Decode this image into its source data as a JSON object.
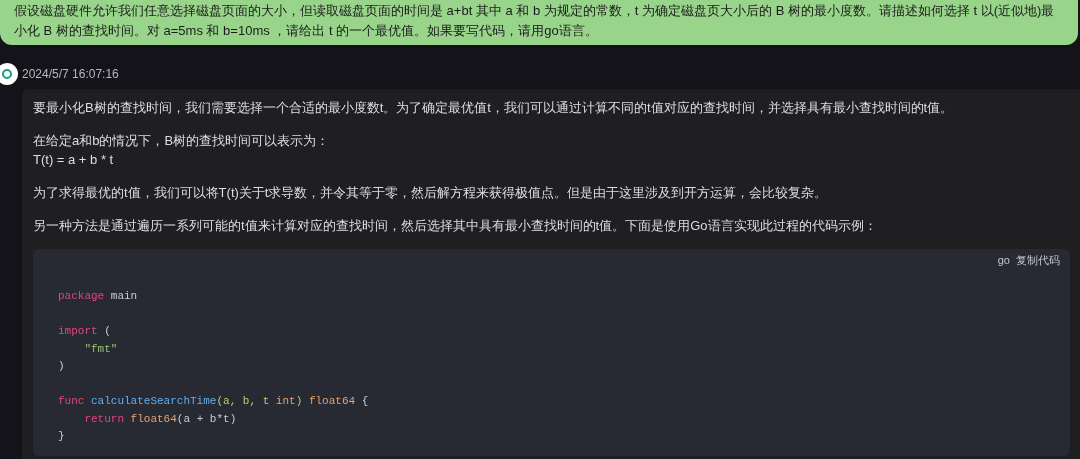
{
  "question": {
    "text": "假设磁盘硬件允许我们任意选择磁盘页面的大小，但读取磁盘页面的时间是 a+bt 其中 a 和 b 为规定的常数，t 为确定磁盘页大小后的 B 树的最小度数。请描述如何选择 t 以(近似地)最小化 B 树的查找时间。对 a=5ms 和 b=10ms ，请给出 t 的一个最优值。如果要写代码，请用go语言。"
  },
  "answer": {
    "timestamp": "2024/5/7 16:07:16",
    "paragraphs": [
      [
        "要最小化B树的查找时间，我们需要选择一个合适的最小度数t。为了确定最优值t，我们可以通过计算不同的t值对应的查找时间，并选择具有最小查找时间的t值。"
      ],
      [
        "在给定a和b的情况下，B树的查找时间可以表示为：",
        "T(t) = a + b * t"
      ],
      [
        "为了求得最优的t值，我们可以将T(t)关于t求导数，并令其等于零，然后解方程来获得极值点。但是由于这里涉及到开方运算，会比较复杂。"
      ],
      [
        "另一种方法是通过遍历一系列可能的t值来计算对应的查找时间，然后选择其中具有最小查找时间的t值。下面是使用Go语言实现此过程的代码示例："
      ]
    ],
    "code": {
      "language": "go",
      "copy_label": "复制代码",
      "lines": [
        {
          "kind": "blank"
        },
        {
          "kind": "code",
          "tokens": [
            {
              "kind": "keyword",
              "text": "package"
            },
            {
              "kind": "plain",
              "text": " main"
            }
          ]
        },
        {
          "kind": "blank"
        },
        {
          "kind": "code",
          "tokens": [
            {
              "kind": "keyword",
              "text": "import"
            },
            {
              "kind": "plain",
              "text": " ("
            }
          ]
        },
        {
          "kind": "code",
          "tokens": [
            {
              "kind": "string",
              "text": "    \"fmt\""
            }
          ]
        },
        {
          "kind": "code",
          "tokens": [
            {
              "kind": "plain",
              "text": ")"
            }
          ]
        },
        {
          "kind": "blank"
        },
        {
          "kind": "code",
          "tokens": [
            {
              "kind": "keyword",
              "text": "func"
            },
            {
              "kind": "function",
              "text": " calculateSearchTime"
            },
            {
              "kind": "param",
              "text": "(a, b, t "
            },
            {
              "kind": "type",
              "text": "int"
            },
            {
              "kind": "param",
              "text": ")"
            },
            {
              "kind": "type",
              "text": " float64"
            },
            {
              "kind": "plain",
              "text": " {"
            }
          ]
        },
        {
          "kind": "code",
          "tokens": [
            {
              "kind": "keyword",
              "text": "    return"
            },
            {
              "kind": "type",
              "text": " float64"
            },
            {
              "kind": "plain",
              "text": "(a + b*t)"
            }
          ]
        },
        {
          "kind": "code",
          "tokens": [
            {
              "kind": "plain",
              "text": "}"
            }
          ]
        }
      ]
    }
  }
}
